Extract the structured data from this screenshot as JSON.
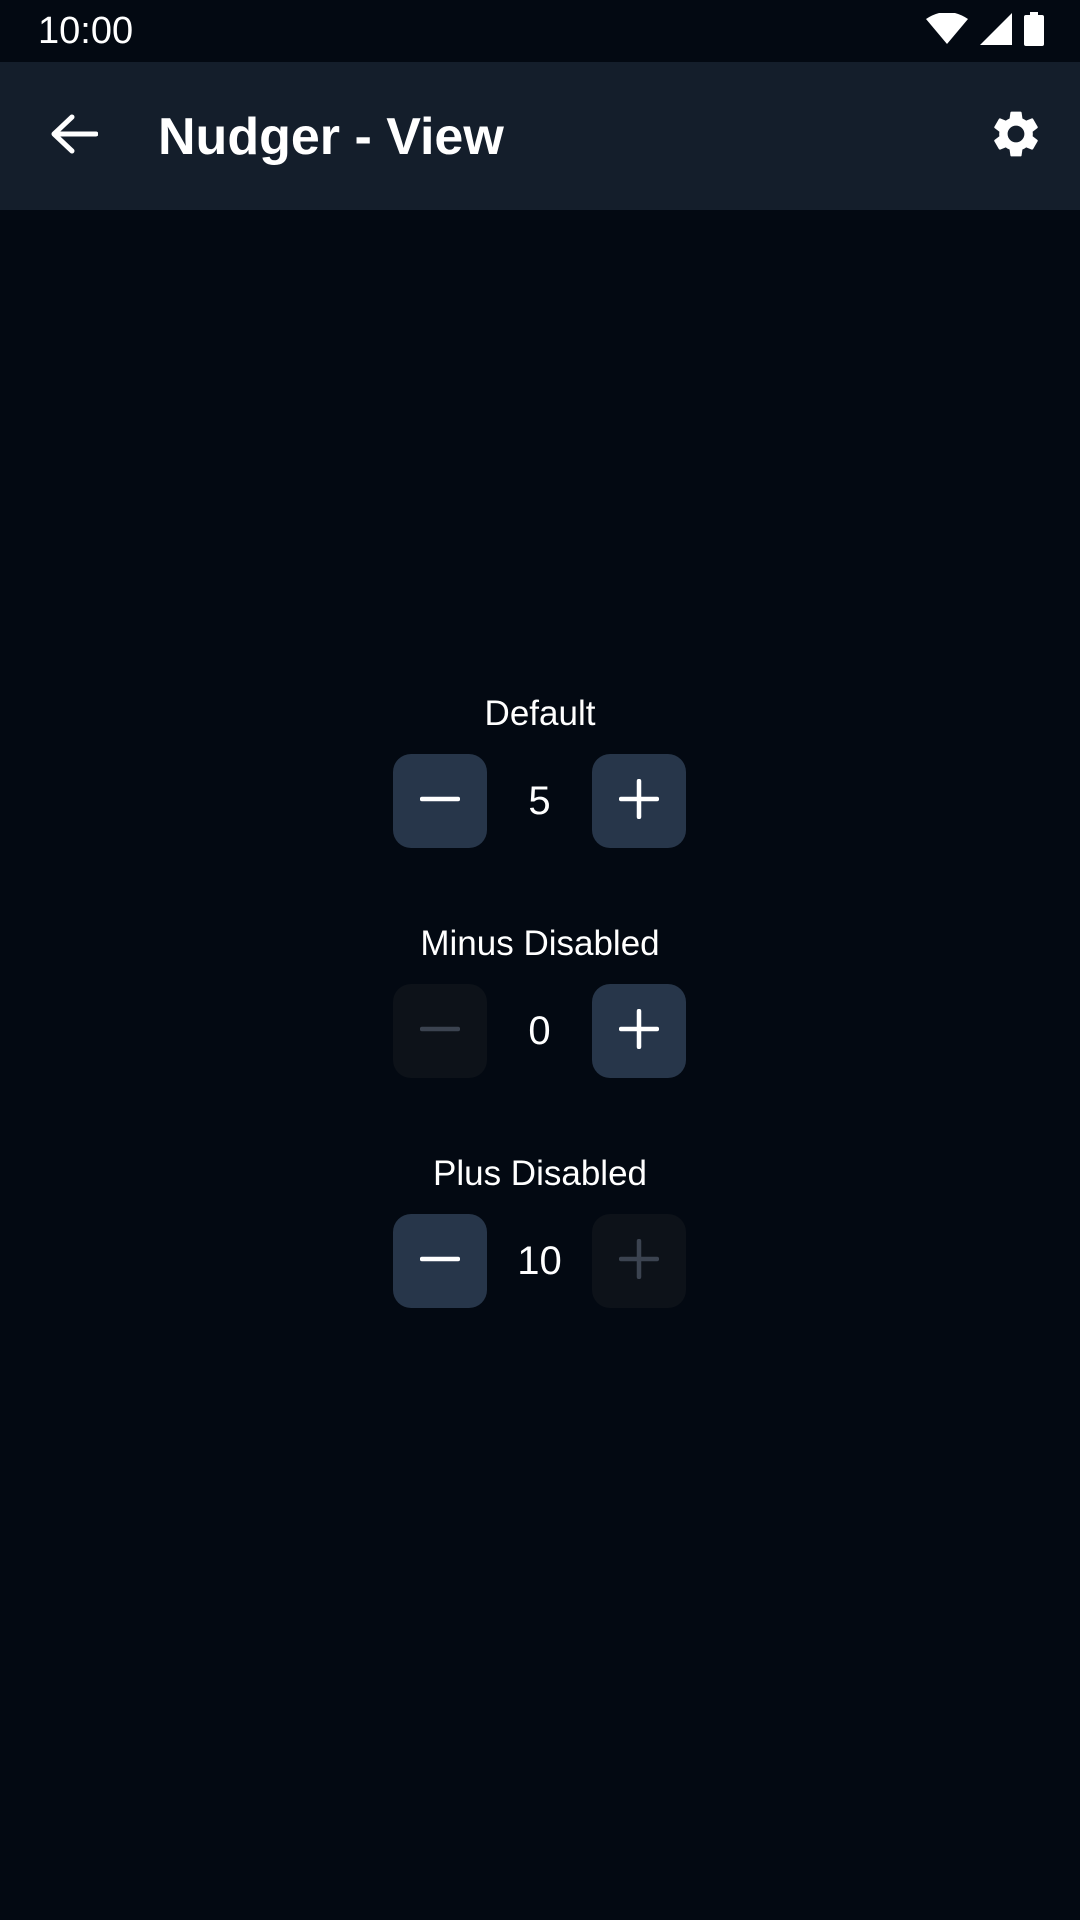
{
  "status_bar": {
    "time": "10:00",
    "icons": [
      "wifi-icon",
      "cell-signal-icon",
      "battery-icon"
    ]
  },
  "app_bar": {
    "title": "Nudger - View",
    "back_icon": "arrow-left-icon",
    "settings_icon": "gear-icon"
  },
  "colors": {
    "background": "#030912",
    "app_bar": "#141e2b",
    "button_enabled": "#27364a",
    "button_disabled": "#0d1219",
    "icon_disabled": "#3b4350"
  },
  "nudgers": [
    {
      "label": "Default",
      "value": "5",
      "minus_enabled": true,
      "plus_enabled": true
    },
    {
      "label": "Minus Disabled",
      "value": "0",
      "minus_enabled": false,
      "plus_enabled": true
    },
    {
      "label": "Plus Disabled",
      "value": "10",
      "minus_enabled": true,
      "plus_enabled": false
    }
  ]
}
